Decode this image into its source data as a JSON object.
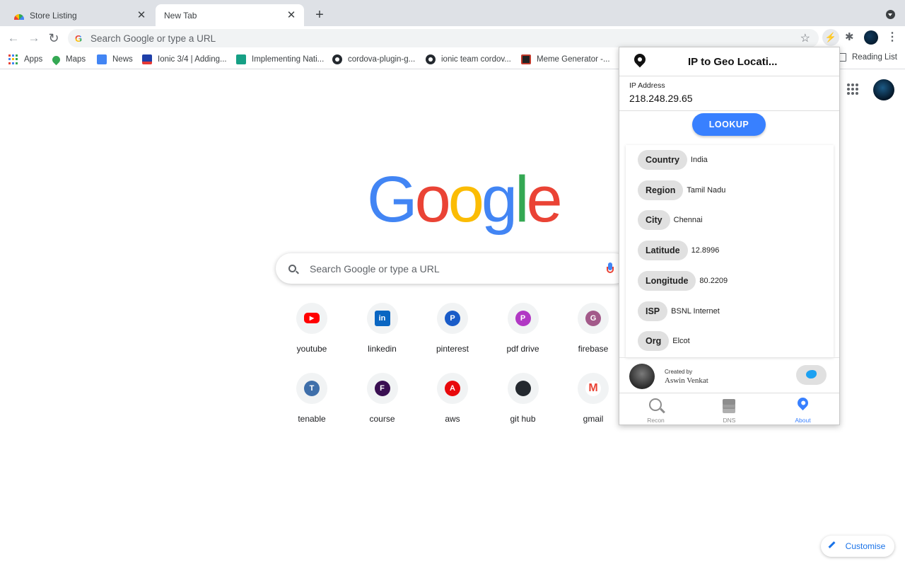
{
  "browser": {
    "tabs": [
      {
        "title": "Store Listing",
        "active": false
      },
      {
        "title": "New Tab",
        "active": true
      }
    ],
    "omnibox_placeholder": "Search Google or type a URL",
    "bookmarks": [
      "Apps",
      "Maps",
      "News",
      "Ionic 3/4 | Adding...",
      "Implementing Nati...",
      "cordova-plugin-g...",
      "ionic team cordov...",
      "Meme Generator -..."
    ],
    "reading_list": "Reading List"
  },
  "ntp": {
    "logo": [
      "G",
      "o",
      "o",
      "g",
      "l",
      "e"
    ],
    "search_placeholder": "Search Google or type a URL",
    "shortcuts": [
      {
        "label": "youtube",
        "icon": "youtube-icon",
        "letter": "▶",
        "color": "#ff0000"
      },
      {
        "label": "linkedin",
        "icon": "linkedin-icon",
        "letter": "in",
        "color": "#0a66c2"
      },
      {
        "label": "pinterest",
        "icon": "letter-p-icon",
        "letter": "P",
        "color": "#1a5cc8"
      },
      {
        "label": "pdf drive",
        "icon": "letter-p-icon",
        "letter": "P",
        "color": "#b138c4"
      },
      {
        "label": "firebase",
        "icon": "letter-g-icon",
        "letter": "G",
        "color": "#a35a8a"
      },
      {
        "label": "tenable",
        "icon": "letter-t-icon",
        "letter": "T",
        "color": "#3f6faa"
      },
      {
        "label": "course",
        "icon": "letter-f-icon",
        "letter": "F",
        "color": "#3a0f52"
      },
      {
        "label": "aws",
        "icon": "letter-a-icon",
        "letter": "A",
        "color": "#e8090c"
      },
      {
        "label": "git hub",
        "icon": "github-icon",
        "letter": "",
        "color": "#24292f"
      },
      {
        "label": "gmail",
        "icon": "gmail-icon",
        "letter": "M",
        "color": "#ea4335"
      }
    ],
    "customise": "Customise"
  },
  "popup": {
    "title": "IP to Geo Locati...",
    "ip_label": "IP Address",
    "ip_value": "218.248.29.65",
    "lookup_label": "LOOKUP",
    "results": [
      {
        "label": "Country",
        "value": "India"
      },
      {
        "label": "Region",
        "value": "Tamil Nadu"
      },
      {
        "label": "City",
        "value": "Chennai"
      },
      {
        "label": "Latitude",
        "value": "12.8996"
      },
      {
        "label": "Longitude",
        "value": "80.2209"
      },
      {
        "label": "ISP",
        "value": "BSNL Internet"
      },
      {
        "label": "Org",
        "value": "Elcot"
      }
    ],
    "created_by": "Created by",
    "author": "Aswin Venkat",
    "tabs": [
      {
        "label": "Recon",
        "icon": "search-icon",
        "active": false
      },
      {
        "label": "DNS",
        "icon": "layers-icon",
        "active": false
      },
      {
        "label": "About",
        "icon": "location-pin-icon",
        "active": true
      }
    ],
    "accent": "#3880ff"
  }
}
